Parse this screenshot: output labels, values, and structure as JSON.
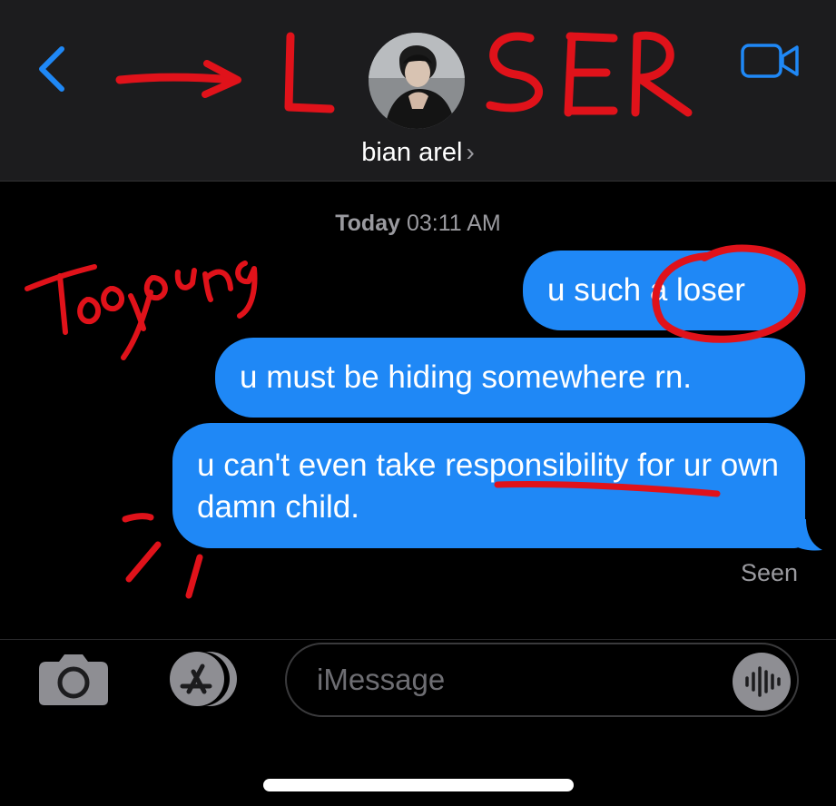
{
  "header": {
    "contact_name": "bian arel",
    "chevron": "›",
    "back_icon": "chevron-left-icon",
    "video_icon": "video-camera-icon",
    "accent": "#1f88f6"
  },
  "thread": {
    "timestamp_day": "Today",
    "timestamp_time": "03:11 AM",
    "messages": [
      {
        "text": "u such a loser",
        "sent": true
      },
      {
        "text": "u must be hiding somewhere rn.",
        "sent": true
      },
      {
        "text": "u can't even take responsibility for ur own damn child.",
        "sent": true
      }
    ],
    "status": "Seen",
    "bubble_color": "#1f88f6"
  },
  "composer": {
    "placeholder": "iMessage",
    "camera_icon": "camera-icon",
    "apps_icon": "app-store-icon",
    "audio_icon": "audio-waveform-icon"
  },
  "annotations": {
    "color": "#e0121a",
    "items": [
      {
        "type": "arrow",
        "target": "contact-name"
      },
      {
        "type": "text",
        "text": "L"
      },
      {
        "type": "text",
        "text": "SER"
      },
      {
        "type": "text",
        "text": "Too young"
      },
      {
        "type": "circle",
        "target": "loser"
      },
      {
        "type": "underline",
        "target": "responsibility"
      },
      {
        "type": "text",
        "text": ">:("
      }
    ]
  }
}
